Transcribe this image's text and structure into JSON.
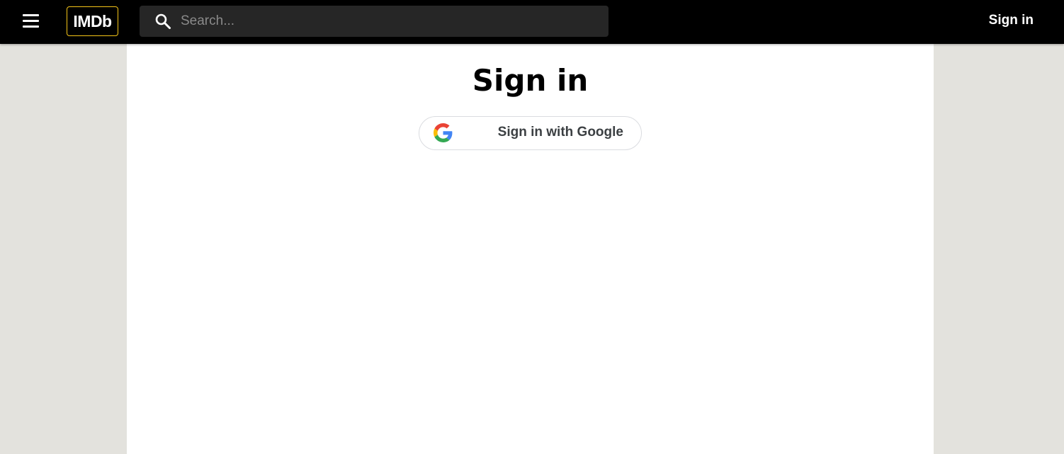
{
  "header": {
    "menu_icon": "hamburger-menu-icon",
    "logo_text": "IMDb",
    "search": {
      "icon": "search-icon",
      "placeholder": "Search...",
      "value": ""
    },
    "signin_label": "Sign in"
  },
  "main": {
    "title": "Sign in",
    "google_button": {
      "icon": "google-g-icon",
      "label": "Sign in with Google"
    }
  },
  "colors": {
    "header_bg": "#000000",
    "logo_border": "#f5c518",
    "search_bg": "#262626",
    "page_bg": "#e3e2dd",
    "content_bg": "#ffffff",
    "google_button_border": "#dadce0",
    "google_blue": "#4285F4",
    "google_red": "#EA4335",
    "google_yellow": "#FBBC05",
    "google_green": "#34A853"
  }
}
